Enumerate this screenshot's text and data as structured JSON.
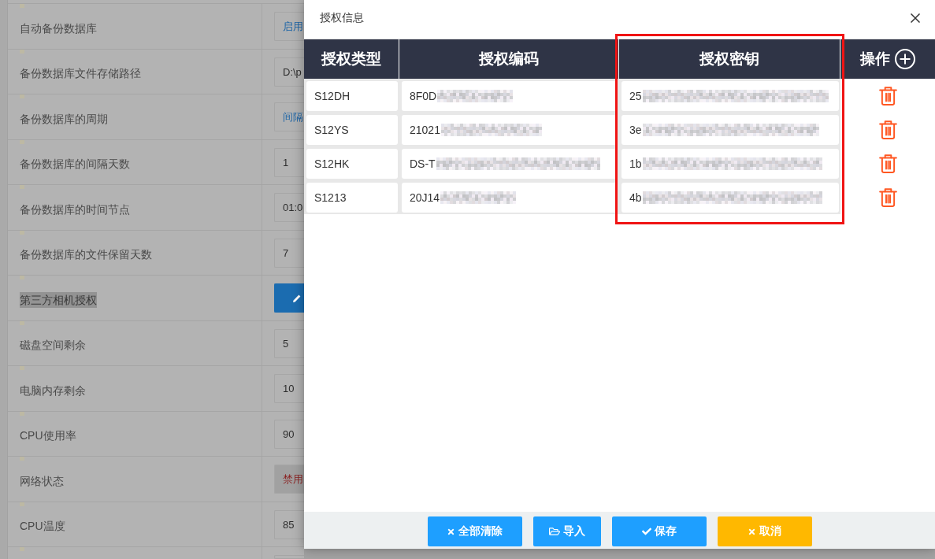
{
  "settings": {
    "rows": [
      {
        "label": "自动备份数据库",
        "kind": "select",
        "value": "启用",
        "disabled": false,
        "text_selected": false
      },
      {
        "label": "备份数据库文件存储路径",
        "kind": "input",
        "value": "D:\\p",
        "disabled": false,
        "text_selected": false
      },
      {
        "label": "备份数据库的周期",
        "kind": "select",
        "value": "间隔",
        "disabled": false,
        "text_selected": false
      },
      {
        "label": "备份数据库的间隔天数",
        "kind": "input",
        "value": "1",
        "disabled": false,
        "text_selected": false
      },
      {
        "label": "备份数据库的时间节点",
        "kind": "input",
        "value": "01:0",
        "disabled": false,
        "text_selected": false
      },
      {
        "label": "备份数据库的文件保留天数",
        "kind": "input",
        "value": "7",
        "disabled": false,
        "text_selected": false
      },
      {
        "label": "第三方相机授权",
        "kind": "edit_button",
        "disabled": false,
        "text_selected": true
      },
      {
        "label": "磁盘空间剩余",
        "kind": "input",
        "value": "5",
        "disabled": false,
        "text_selected": false
      },
      {
        "label": "电脑内存剩余",
        "kind": "input",
        "value": "10",
        "disabled": false,
        "text_selected": false
      },
      {
        "label": "CPU使用率",
        "kind": "input",
        "value": "90",
        "disabled": false,
        "text_selected": false
      },
      {
        "label": "网络状态",
        "kind": "select",
        "value": "禁用",
        "disabled": true,
        "text_selected": false
      },
      {
        "label": "CPU温度",
        "kind": "input",
        "value": "85",
        "disabled": false,
        "text_selected": false
      },
      {
        "kind": "input",
        "disabled": false
      }
    ]
  },
  "dialog": {
    "title": "授权信息",
    "table": {
      "columns": [
        {
          "label": "授权类型",
          "kind": "text"
        },
        {
          "label": "授权编码",
          "kind": "text"
        },
        {
          "label": "授权密钥",
          "kind": "framed"
        },
        {
          "label": "操作",
          "kind": "actions"
        }
      ],
      "rows": [
        {
          "cells": [
            {
              "text": "S12DH",
              "redacted": false
            },
            {
              "text": "8F0D",
              "redacted": true
            },
            {
              "text": "25",
              "redacted": true
            }
          ]
        },
        {
          "cells": [
            {
              "text": "S12YS",
              "redacted": false
            },
            {
              "text": "21021",
              "redacted": true
            },
            {
              "text": "3e",
              "redacted": true
            }
          ]
        },
        {
          "cells": [
            {
              "text": "S12HK",
              "redacted": false
            },
            {
              "text": "DS-T",
              "redacted": true
            },
            {
              "text": "1b",
              "redacted": true
            }
          ]
        },
        {
          "cells": [
            {
              "text": "S1213",
              "redacted": false
            },
            {
              "text": "20J14",
              "redacted": true
            },
            {
              "text": "4b",
              "redacted": true
            }
          ]
        }
      ]
    },
    "buttons": [
      {
        "label": "全部清除",
        "kind": "clear"
      },
      {
        "label": "导入",
        "kind": "import"
      },
      {
        "label": "保存",
        "kind": "save"
      },
      {
        "label": "取消",
        "kind": "cancel"
      }
    ]
  }
}
